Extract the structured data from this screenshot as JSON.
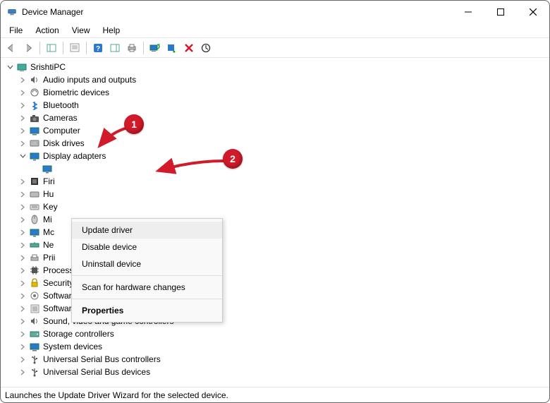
{
  "window": {
    "title": "Device Manager"
  },
  "menubar": {
    "items": [
      "File",
      "Action",
      "View",
      "Help"
    ]
  },
  "tree": {
    "root": "SrishtiPC",
    "categories": [
      {
        "label": "Audio inputs and outputs",
        "expanded": false
      },
      {
        "label": "Biometric devices",
        "expanded": false
      },
      {
        "label": "Bluetooth",
        "expanded": false
      },
      {
        "label": "Cameras",
        "expanded": false
      },
      {
        "label": "Computer",
        "expanded": false
      },
      {
        "label": "Disk drives",
        "expanded": false
      },
      {
        "label": "Display adapters",
        "expanded": true
      },
      {
        "label": "Firi",
        "expanded": false
      },
      {
        "label": "Hu",
        "expanded": false
      },
      {
        "label": "Key",
        "expanded": false
      },
      {
        "label": "Mi",
        "expanded": false
      },
      {
        "label": "Mc",
        "expanded": false
      },
      {
        "label": "Ne",
        "expanded": false
      },
      {
        "label": "Print queues",
        "expanded": false,
        "clipped": "Prii"
      },
      {
        "label": "Processors",
        "expanded": false
      },
      {
        "label": "Security devices",
        "expanded": false
      },
      {
        "label": "Software components",
        "expanded": false
      },
      {
        "label": "Software devices",
        "expanded": false
      },
      {
        "label": "Sound, video and game controllers",
        "expanded": false
      },
      {
        "label": "Storage controllers",
        "expanded": false
      },
      {
        "label": "System devices",
        "expanded": false
      },
      {
        "label": "Universal Serial Bus controllers",
        "expanded": false
      },
      {
        "label": "Universal Serial Bus devices",
        "expanded": false
      }
    ]
  },
  "context_menu": {
    "items": [
      "Update driver",
      "Disable device",
      "Uninstall device",
      "Scan for hardware changes",
      "Properties"
    ]
  },
  "status": "Launches the Update Driver Wizard for the selected device.",
  "callouts": {
    "one": "1",
    "two": "2"
  }
}
